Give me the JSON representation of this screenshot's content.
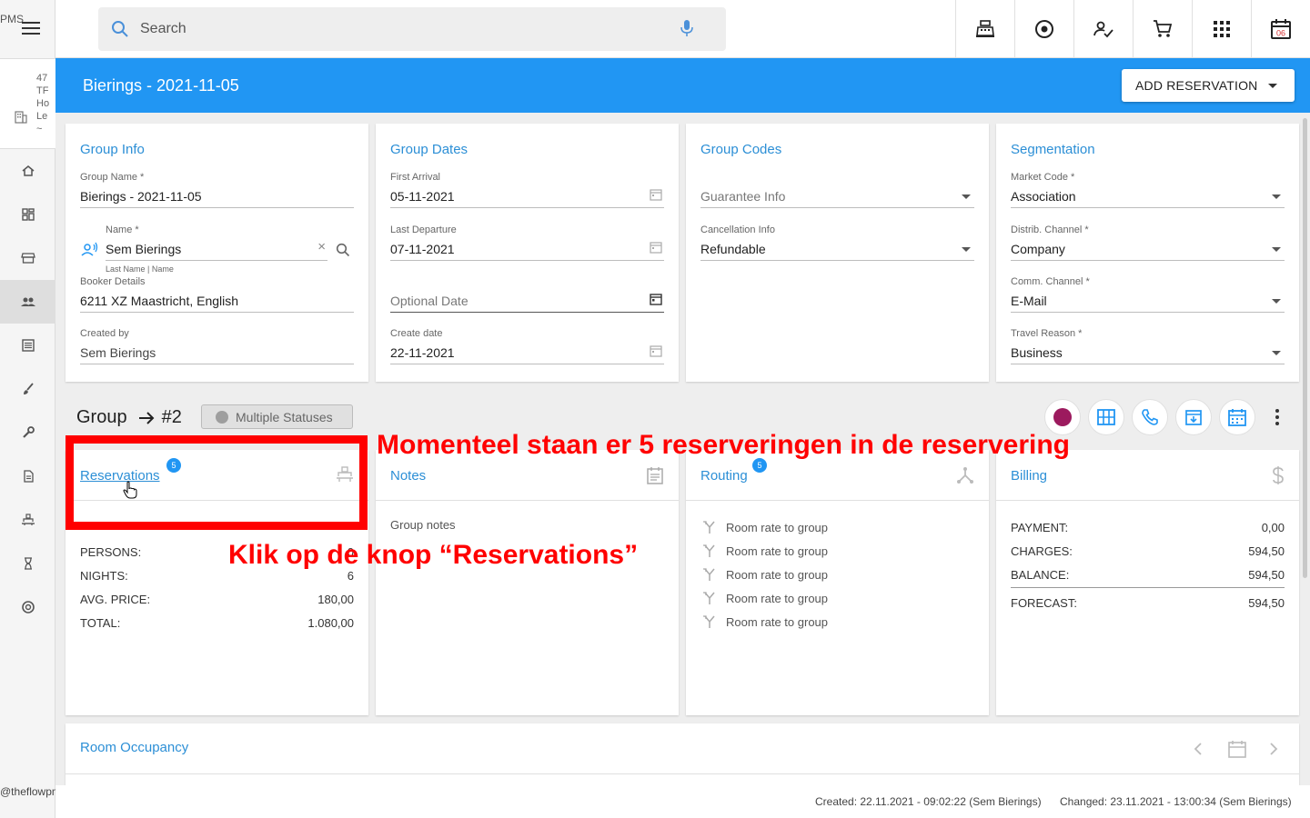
{
  "sidebar": {
    "brand": "PMS",
    "hotel_lines": [
      "47",
      "TF",
      "Ho",
      "Le",
      "~"
    ],
    "footer": "@theflowpms",
    "items": [
      {
        "name": "home-icon"
      },
      {
        "name": "dashboard-icon"
      },
      {
        "name": "store-icon"
      },
      {
        "name": "groups-icon",
        "active": true
      },
      {
        "name": "list-icon"
      },
      {
        "name": "brush-icon"
      },
      {
        "name": "wrench-icon"
      },
      {
        "name": "document-icon"
      },
      {
        "name": "room-service-icon"
      },
      {
        "name": "hourglass-icon"
      },
      {
        "name": "support-icon"
      }
    ]
  },
  "topbar": {
    "search_placeholder": "Search",
    "calendar_day": "06",
    "buttons": [
      "cash-register-icon",
      "target-icon",
      "user-check-icon",
      "cart-icon",
      "apps-grid-icon",
      "calendar-icon"
    ]
  },
  "header": {
    "title": "Bierings - 2021-11-05",
    "add_reservation": "ADD RESERVATION"
  },
  "group_info": {
    "title": "Group Info",
    "group_name_label": "Group Name *",
    "group_name": "Bierings - 2021-11-05",
    "name_label": "Name *",
    "name": "Sem Bierings",
    "name_hint": "Last Name | Name",
    "booker_label": "Booker Details",
    "booker": "6211 XZ Maastricht, English",
    "created_by_label": "Created by",
    "created_by": "Sem Bierings"
  },
  "group_dates": {
    "title": "Group Dates",
    "first_arrival_label": "First Arrival",
    "first_arrival": "05-11-2021",
    "last_departure_label": "Last Departure",
    "last_departure": "07-11-2021",
    "optional_date_placeholder": "Optional Date",
    "create_date_label": "Create date",
    "create_date": "22-11-2021"
  },
  "group_codes": {
    "title": "Group Codes",
    "guarantee_placeholder": "Guarantee Info",
    "cancellation_label": "Cancellation Info",
    "cancellation": "Refundable"
  },
  "segmentation": {
    "title": "Segmentation",
    "market_code_label": "Market Code *",
    "market_code": "Association",
    "distrib_label": "Distrib. Channel *",
    "distrib": "Company",
    "comm_label": "Comm. Channel *",
    "comm": "E-Mail",
    "travel_label": "Travel Reason *",
    "travel": "Business"
  },
  "group_row": {
    "group": "Group",
    "number": "#2",
    "status": "Multiple Statuses",
    "status_color": "#9e9e9e",
    "color_dot": "#9c1a5e"
  },
  "reservations": {
    "title": "Reservations",
    "badge": "5",
    "persons_label": "PERSONS:",
    "persons": "0",
    "nights_label": "NIGHTS:",
    "nights": "6",
    "avg_label": "AVG. PRICE:",
    "avg": "180,00",
    "total_label": "TOTAL:",
    "total": "1.080,00"
  },
  "notes": {
    "title": "Notes",
    "text": "Group notes"
  },
  "routing": {
    "title": "Routing",
    "badge": "5",
    "items": [
      "Room rate to group",
      "Room rate to group",
      "Room rate to group",
      "Room rate to group",
      "Room rate to group"
    ]
  },
  "billing": {
    "title": "Billing",
    "payment_label": "PAYMENT:",
    "payment": "0,00",
    "charges_label": "CHARGES:",
    "charges": "594,50",
    "balance_label": "BALANCE:",
    "balance": "594,50",
    "forecast_label": "FORECAST:",
    "forecast": "594,50"
  },
  "room_occupancy": {
    "title": "Room Occupancy"
  },
  "statusbar": {
    "created": "Created: 22.11.2021 - 09:02:22 (Sem Bierings)",
    "changed": "Changed: 23.11.2021 - 13:00:34 (Sem Bierings)"
  },
  "annotations": {
    "top": "Momenteel staan er 5 reserveringen in de reservering",
    "bottom": "Klik op de knop “Reservations”",
    "color": "#ff0000"
  }
}
